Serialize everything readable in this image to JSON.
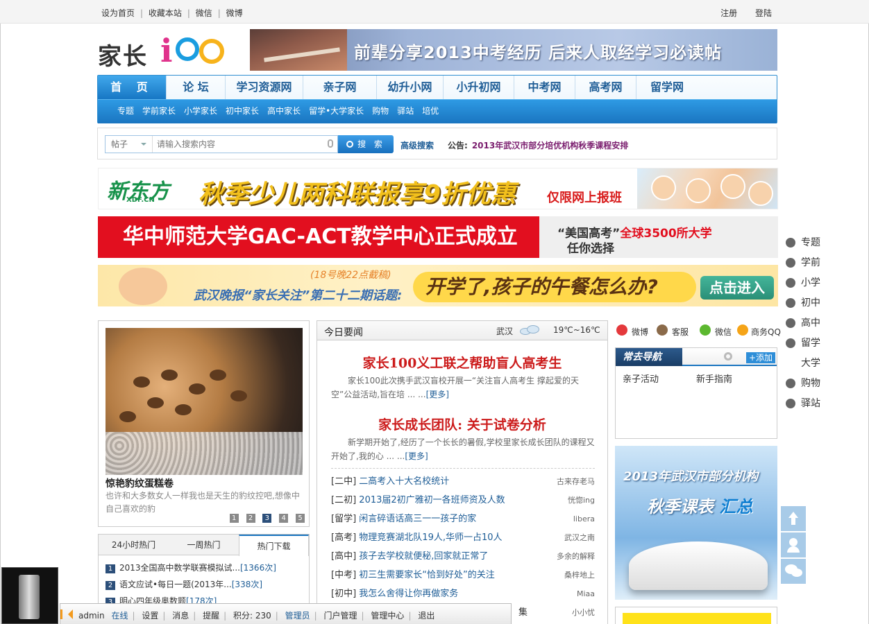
{
  "topbar": {
    "links": [
      "设为首页",
      "收藏本站",
      "微信",
      "微博"
    ],
    "separator": "|",
    "register": "注册",
    "login": "登陆"
  },
  "logo": {
    "text_a": "家长",
    "text_i": "i"
  },
  "top_banner": {
    "text": "前辈分享2013中考经历 后来人取经学习必读帖"
  },
  "nav": {
    "main": [
      "首 页",
      "论 坛",
      "学习资源网",
      "亲子网",
      "幼升小网",
      "小升初网",
      "中考网",
      "高考网",
      "留学网"
    ],
    "sub": [
      "专题",
      "学前家长",
      "小学家长",
      "初中家长",
      "高中家长",
      "留学•大学家长",
      "购物",
      "驿站",
      "培优"
    ]
  },
  "search": {
    "category": "帖子",
    "placeholder": "请输入搜索内容",
    "button": "搜 索",
    "advanced": "高级搜索",
    "notice_label": "公告:",
    "notice_text": "2013年武汉市部分培优机构秋季课程安排"
  },
  "banner1": {
    "brand": "新东方",
    "brand_cn": "XDF.CN",
    "slogan": "秋季少儿两科联报享9折优惠",
    "tag": "仅限网上报班"
  },
  "banner2": {
    "main": "华中师范大学GAC-ACT教学中心正式成立",
    "line1_red": "“美国高考”",
    "line1_rest": "全球3500所大学",
    "line2": "任你选择"
  },
  "banner3": {
    "deadline": "(18号晚22点截稿)",
    "title": "武汉晚报“家长关注”第二十二期话题:",
    "topic": "开学了,孩子的午餐怎么办?",
    "enter": "点击进入"
  },
  "slide": {
    "title": "惊艳豹纹蛋糕卷",
    "desc": "也许和大多数女人一样我也是天生的豹纹控吧,想像中自己喜欢的豹",
    "pages": [
      "1",
      "2",
      "3",
      "4",
      "5"
    ],
    "active": "3"
  },
  "hot": {
    "tabs": [
      "24小时热门",
      "一周热门",
      "热门下载"
    ],
    "items": [
      {
        "num": "1",
        "title": "2013全国高中数学联赛模拟试...",
        "count": "[1366次]"
      },
      {
        "num": "2",
        "title": "语文应试•每日一题(2013年...",
        "count": "[338次]"
      },
      {
        "num": "3",
        "title": "明心四年级奥数题",
        "count": "[178次]"
      }
    ]
  },
  "news": {
    "header": "今日要闻",
    "city": "武汉",
    "temp": "19℃~16℃",
    "headline1": "家长100义工联之帮助盲人高考生",
    "para1": "家长100此次携手武汉盲校开展一“关注盲人高考生 撑起爱的天空”公益活动,旨在培 ... ...",
    "headline2": "家长成长团队: 关于试卷分析",
    "para2": "新学期开始了,经历了一个长长的暑假,学校里家长成长团队的课程又开始了,我的心 ... ...",
    "more": "[更多]",
    "items": [
      {
        "tag": "[二中]",
        "title": "二高考入十大名校统计",
        "author": "古来存老马"
      },
      {
        "tag": "[二初]",
        "title": "2013届2初广雅初一各班师资及人数",
        "author": "恍惚ing"
      },
      {
        "tag": "[留学]",
        "title": "闲言碎语话高三一一孩子的家",
        "author": "libera"
      },
      {
        "tag": "[高考]",
        "title": "物理竞赛湖北队19人,华师一占10人",
        "author": "武汉之南"
      },
      {
        "tag": "[高中]",
        "title": "孩子去学校就便秘,回家就正常了",
        "author": "多余的解释"
      },
      {
        "tag": "[中考]",
        "title": "初三生需要家长“恰到好处”的关注",
        "author": "桑梓地上"
      },
      {
        "tag": "[初中]",
        "title": "我怎么舍得让你再做家务",
        "author": "Miaa"
      },
      {
        "tag": "",
        "title": "集",
        "author": "小小忧"
      }
    ]
  },
  "social": [
    "微博",
    "客服",
    "微信",
    "商务QQ"
  ],
  "often": {
    "title": "常去导航",
    "add": "+添加",
    "links": [
      "亲子活动",
      "新手指南"
    ]
  },
  "courses": {
    "line1": "2013年武汉市部分机构",
    "line2a": "秋季课表 ",
    "line2b": "汇总"
  },
  "sidenav": [
    "专题",
    "学前",
    "小学",
    "初中",
    "高中",
    "留学",
    "大学",
    "购物",
    "驿站"
  ],
  "bottombar": {
    "user": "admin",
    "status": "在线",
    "items": [
      "设置",
      "消息",
      "提醒"
    ],
    "points": "积分: 230",
    "role": "管理员",
    "items2": [
      "门户管理",
      "管理中心",
      "退出"
    ]
  },
  "colors": {
    "brand_blue": "#1a75c0",
    "headline_red": "#cc1b1b",
    "link_blue": "#1e5d96"
  }
}
